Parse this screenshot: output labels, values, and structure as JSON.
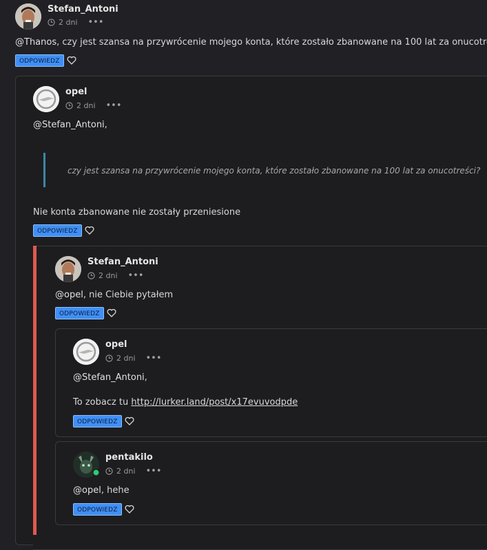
{
  "reply_label": "ODPOWIEDZ",
  "colors": {
    "reply_button": "#3f8ff7",
    "quote_bar": "#3f86a6",
    "thread_bar": "#e0594f",
    "online_dot": "#2ecc71"
  },
  "posts": [
    {
      "author": "Stefan_Antoni",
      "time": "2 dni",
      "mention": "@Thanos",
      "body": ", czy jest szansa na przywrócenie mojego konta, które zostało zbanowane na 100 lat za onucotreści?"
    },
    {
      "author": "opel",
      "time": "2 dni",
      "mention": "@Stefan_Antoni",
      "mention_suffix": ",",
      "quote": "czy jest szansa na przywrócenie mojego konta, które zostało zbanowane na 100 lat za onucotreści?",
      "body": "Nie konta zbanowane nie zostały przeniesione"
    },
    {
      "author": "Stefan_Antoni",
      "time": "2 dni",
      "mention": "@opel",
      "body": ", nie Ciebie pytałem"
    },
    {
      "author": "opel",
      "time": "2 dni",
      "mention": "@Stefan_Antoni",
      "mention_suffix": ",",
      "body_prefix": "To zobacz tu ",
      "link": "http://lurker.land/post/x17evuvodpde"
    },
    {
      "author": "pentakilo",
      "time": "2 dni",
      "mention": "@opel",
      "body": ", hehe"
    }
  ]
}
